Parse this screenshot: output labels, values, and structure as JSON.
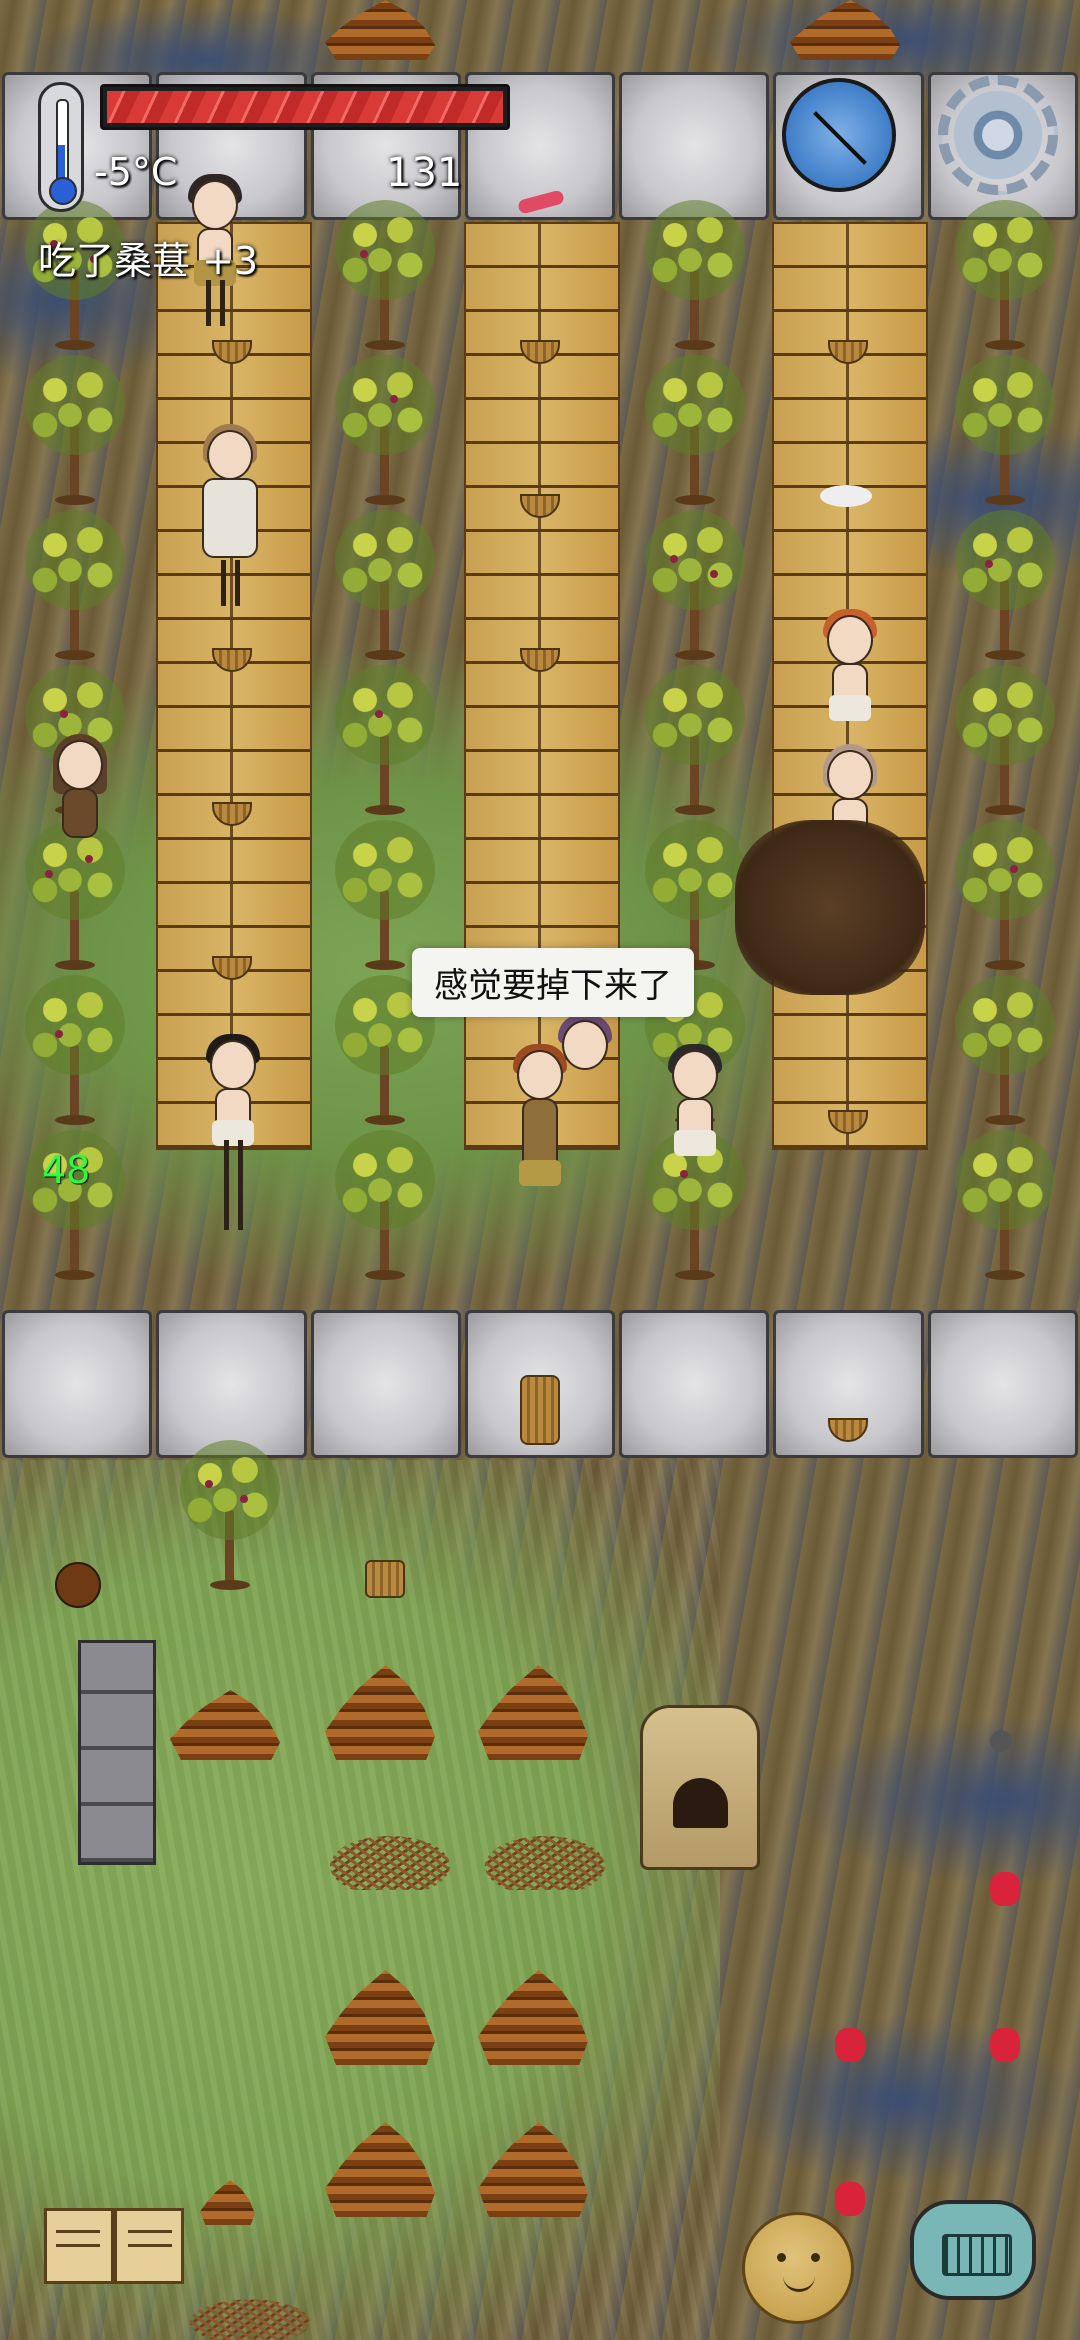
{
  "hud": {
    "temperature": "-5°C",
    "age": "131",
    "food_meter_fraction": 1.0,
    "status_message": "吃了桑葚 +3",
    "lifetime_counter": "48",
    "speech_text": "感觉要掉下来了"
  },
  "icons": {
    "thermometer": "thermometer-icon",
    "food": "food-meter-icon",
    "compass": "compass-icon",
    "settings": "gear-icon",
    "tech_book": "book-icon",
    "emote": "potato-face-icon",
    "chat": "keyboard-icon"
  },
  "colors": {
    "food_bar": "#d83a36",
    "lifetime_text": "#28ff3a",
    "thermometer_fill": "#2b5fd6",
    "compass": "#3f7ec8",
    "chat_button": "#78b7b5"
  }
}
